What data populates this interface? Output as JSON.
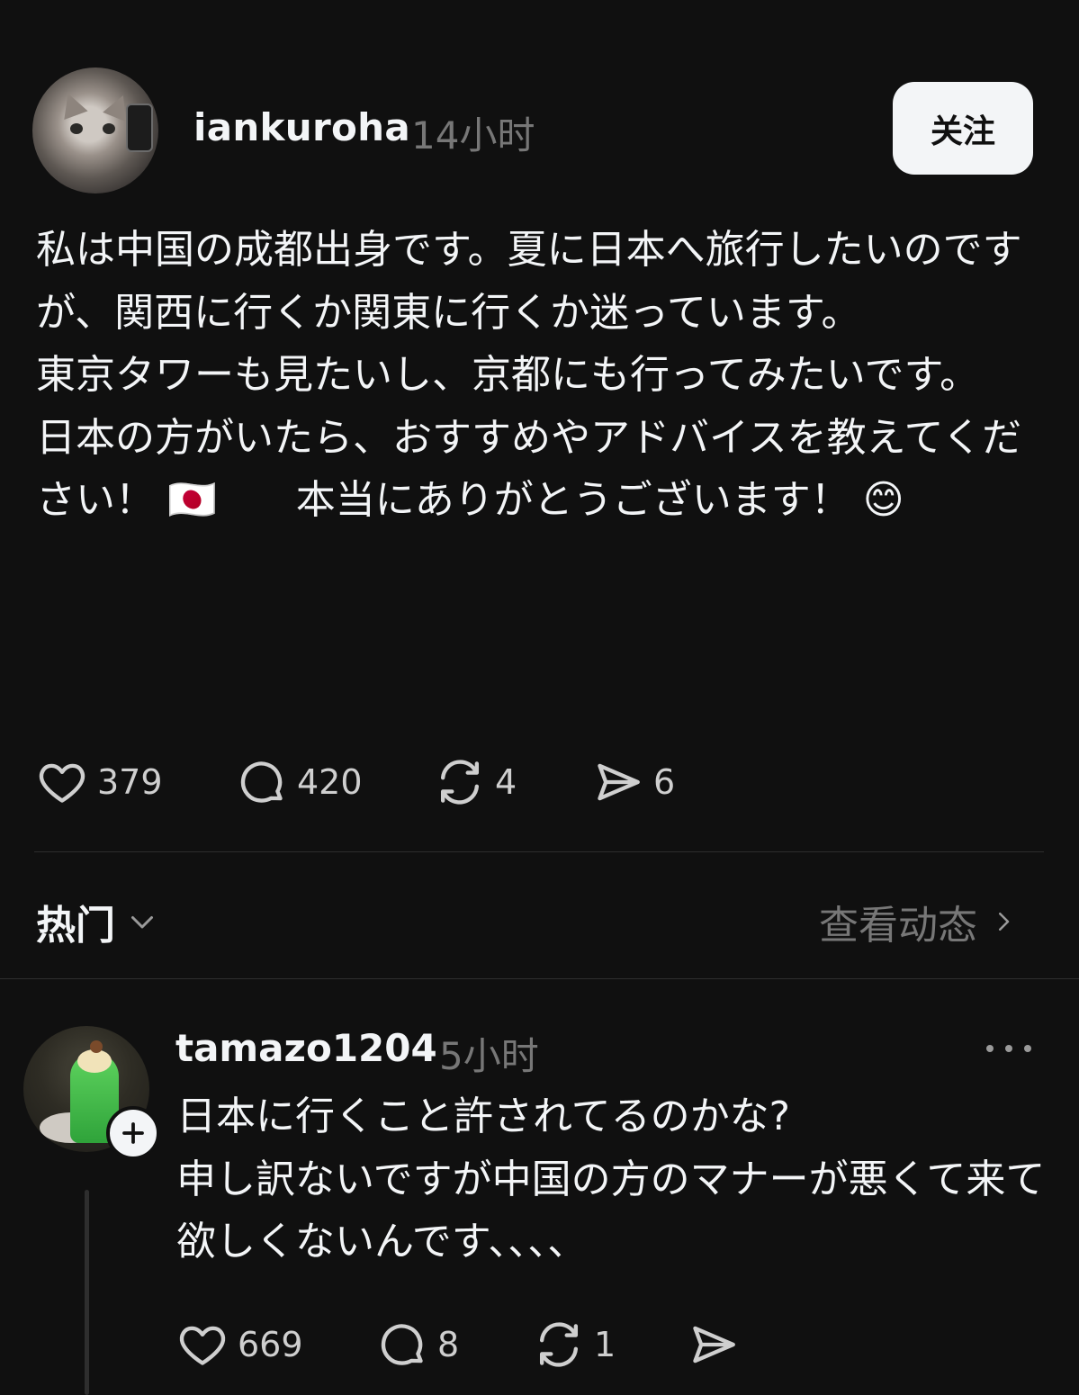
{
  "post": {
    "username": "iankuroha",
    "timestamp": "14小时",
    "follow_label": "关注",
    "body": "私は中国の成都出身です。夏に日本へ旅行したいのですが、関西に行くか関東に行くか迷っています。\n東京タワーも見たいし、京都にも行ってみたいです。\n日本の方がいたら、おすすめやアドバイスを教えてください！ 🇯🇵　　本当にありがとうございます！ 😊",
    "actions": {
      "likes": "379",
      "comments": "420",
      "reposts": "4",
      "shares": "6"
    }
  },
  "sort": {
    "label": "热门",
    "activity_link": "查看动态"
  },
  "reply": {
    "username": "tamazo1204",
    "timestamp": "5小时",
    "body": "日本に行くこと許されてるのかな?\n申し訳ないですが中国の方のマナーが悪くて来て欲しくないんです、、、、",
    "actions": {
      "likes": "669",
      "comments": "8",
      "reposts": "1"
    }
  },
  "colors": {
    "background": "#101010",
    "text_primary": "#f3f5f7",
    "text_secondary": "#777777",
    "divider": "#2e2e2e"
  },
  "icons": [
    "heart-icon",
    "comment-icon",
    "repost-icon",
    "share-icon",
    "chevron-down-icon",
    "chevron-right-icon",
    "plus-icon",
    "more-icon"
  ]
}
